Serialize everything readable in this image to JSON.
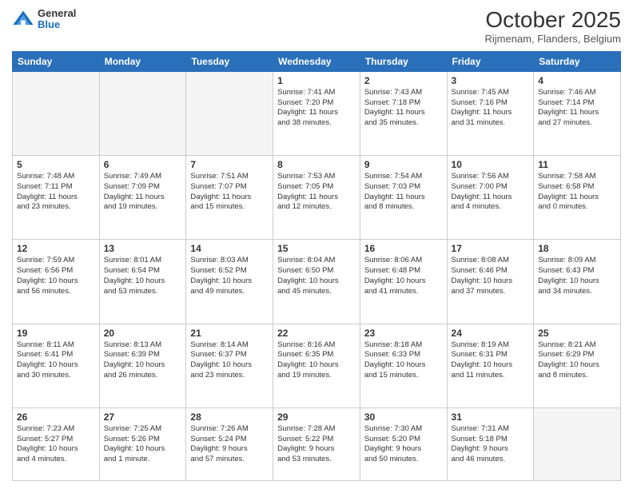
{
  "logo": {
    "general": "General",
    "blue": "Blue"
  },
  "title": "October 2025",
  "subtitle": "Rijmenam, Flanders, Belgium",
  "days_header": [
    "Sunday",
    "Monday",
    "Tuesday",
    "Wednesday",
    "Thursday",
    "Friday",
    "Saturday"
  ],
  "weeks": [
    [
      {
        "day": "",
        "info": ""
      },
      {
        "day": "",
        "info": ""
      },
      {
        "day": "",
        "info": ""
      },
      {
        "day": "1",
        "info": "Sunrise: 7:41 AM\nSunset: 7:20 PM\nDaylight: 11 hours\nand 38 minutes."
      },
      {
        "day": "2",
        "info": "Sunrise: 7:43 AM\nSunset: 7:18 PM\nDaylight: 11 hours\nand 35 minutes."
      },
      {
        "day": "3",
        "info": "Sunrise: 7:45 AM\nSunset: 7:16 PM\nDaylight: 11 hours\nand 31 minutes."
      },
      {
        "day": "4",
        "info": "Sunrise: 7:46 AM\nSunset: 7:14 PM\nDaylight: 11 hours\nand 27 minutes."
      }
    ],
    [
      {
        "day": "5",
        "info": "Sunrise: 7:48 AM\nSunset: 7:11 PM\nDaylight: 11 hours\nand 23 minutes."
      },
      {
        "day": "6",
        "info": "Sunrise: 7:49 AM\nSunset: 7:09 PM\nDaylight: 11 hours\nand 19 minutes."
      },
      {
        "day": "7",
        "info": "Sunrise: 7:51 AM\nSunset: 7:07 PM\nDaylight: 11 hours\nand 15 minutes."
      },
      {
        "day": "8",
        "info": "Sunrise: 7:53 AM\nSunset: 7:05 PM\nDaylight: 11 hours\nand 12 minutes."
      },
      {
        "day": "9",
        "info": "Sunrise: 7:54 AM\nSunset: 7:03 PM\nDaylight: 11 hours\nand 8 minutes."
      },
      {
        "day": "10",
        "info": "Sunrise: 7:56 AM\nSunset: 7:00 PM\nDaylight: 11 hours\nand 4 minutes."
      },
      {
        "day": "11",
        "info": "Sunrise: 7:58 AM\nSunset: 6:58 PM\nDaylight: 11 hours\nand 0 minutes."
      }
    ],
    [
      {
        "day": "12",
        "info": "Sunrise: 7:59 AM\nSunset: 6:56 PM\nDaylight: 10 hours\nand 56 minutes."
      },
      {
        "day": "13",
        "info": "Sunrise: 8:01 AM\nSunset: 6:54 PM\nDaylight: 10 hours\nand 53 minutes."
      },
      {
        "day": "14",
        "info": "Sunrise: 8:03 AM\nSunset: 6:52 PM\nDaylight: 10 hours\nand 49 minutes."
      },
      {
        "day": "15",
        "info": "Sunrise: 8:04 AM\nSunset: 6:50 PM\nDaylight: 10 hours\nand 45 minutes."
      },
      {
        "day": "16",
        "info": "Sunrise: 8:06 AM\nSunset: 6:48 PM\nDaylight: 10 hours\nand 41 minutes."
      },
      {
        "day": "17",
        "info": "Sunrise: 8:08 AM\nSunset: 6:46 PM\nDaylight: 10 hours\nand 37 minutes."
      },
      {
        "day": "18",
        "info": "Sunrise: 8:09 AM\nSunset: 6:43 PM\nDaylight: 10 hours\nand 34 minutes."
      }
    ],
    [
      {
        "day": "19",
        "info": "Sunrise: 8:11 AM\nSunset: 6:41 PM\nDaylight: 10 hours\nand 30 minutes."
      },
      {
        "day": "20",
        "info": "Sunrise: 8:13 AM\nSunset: 6:39 PM\nDaylight: 10 hours\nand 26 minutes."
      },
      {
        "day": "21",
        "info": "Sunrise: 8:14 AM\nSunset: 6:37 PM\nDaylight: 10 hours\nand 23 minutes."
      },
      {
        "day": "22",
        "info": "Sunrise: 8:16 AM\nSunset: 6:35 PM\nDaylight: 10 hours\nand 19 minutes."
      },
      {
        "day": "23",
        "info": "Sunrise: 8:18 AM\nSunset: 6:33 PM\nDaylight: 10 hours\nand 15 minutes."
      },
      {
        "day": "24",
        "info": "Sunrise: 8:19 AM\nSunset: 6:31 PM\nDaylight: 10 hours\nand 11 minutes."
      },
      {
        "day": "25",
        "info": "Sunrise: 8:21 AM\nSunset: 6:29 PM\nDaylight: 10 hours\nand 8 minutes."
      }
    ],
    [
      {
        "day": "26",
        "info": "Sunrise: 7:23 AM\nSunset: 5:27 PM\nDaylight: 10 hours\nand 4 minutes."
      },
      {
        "day": "27",
        "info": "Sunrise: 7:25 AM\nSunset: 5:26 PM\nDaylight: 10 hours\nand 1 minute."
      },
      {
        "day": "28",
        "info": "Sunrise: 7:26 AM\nSunset: 5:24 PM\nDaylight: 9 hours\nand 57 minutes."
      },
      {
        "day": "29",
        "info": "Sunrise: 7:28 AM\nSunset: 5:22 PM\nDaylight: 9 hours\nand 53 minutes."
      },
      {
        "day": "30",
        "info": "Sunrise: 7:30 AM\nSunset: 5:20 PM\nDaylight: 9 hours\nand 50 minutes."
      },
      {
        "day": "31",
        "info": "Sunrise: 7:31 AM\nSunset: 5:18 PM\nDaylight: 9 hours\nand 46 minutes."
      },
      {
        "day": "",
        "info": ""
      }
    ]
  ]
}
